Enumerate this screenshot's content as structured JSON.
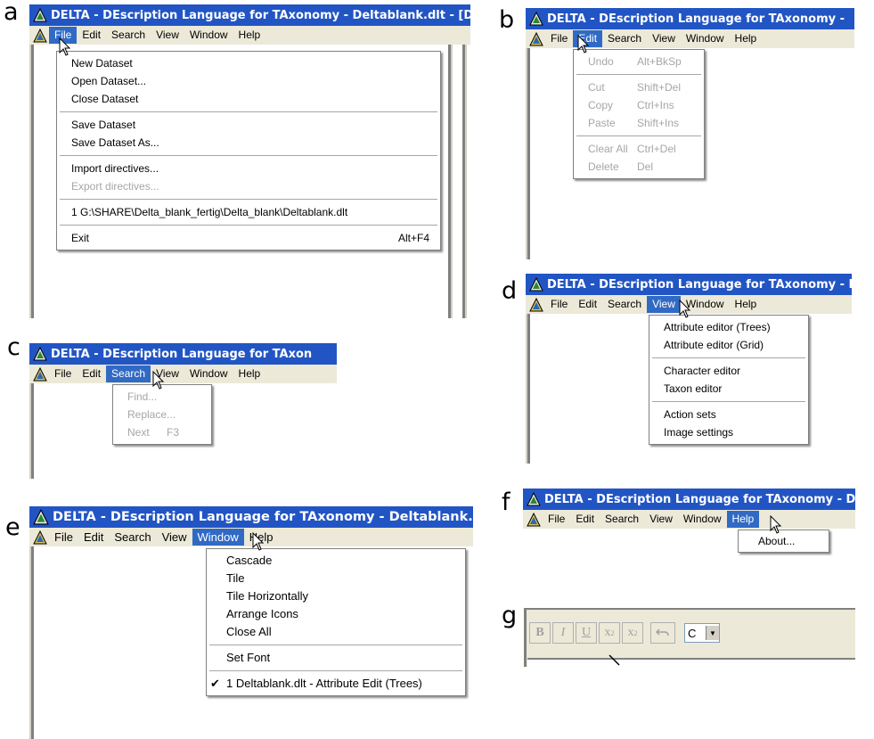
{
  "panels": {
    "a": {
      "letter": "a",
      "title": "DELTA - DEscription Language for TAxonomy - Deltablank.dlt - [Delt",
      "menu": [
        "File",
        "Edit",
        "Search",
        "View",
        "Window",
        "Help"
      ],
      "active_menu": "File",
      "items": {
        "new": "New Dataset",
        "open": "Open Dataset...",
        "close": "Close Dataset",
        "save": "Save Dataset",
        "save_as": "Save Dataset As...",
        "import": "Import directives...",
        "export": "Export directives...",
        "recent": "1 G:\\SHARE\\Delta_blank_fertig\\Delta_blank\\Deltablank.dlt",
        "exit": "Exit",
        "exit_shortcut": "Alt+F4"
      }
    },
    "b": {
      "letter": "b",
      "title": "DELTA - DEscription Language for TAxonomy -",
      "menu": [
        "File",
        "Edit",
        "Search",
        "View",
        "Window",
        "Help"
      ],
      "active_menu": "Edit",
      "items": {
        "undo": "Undo",
        "undo_shortcut": "Alt+BkSp",
        "cut": "Cut",
        "cut_shortcut": "Shift+Del",
        "copy": "Copy",
        "copy_shortcut": "Ctrl+Ins",
        "paste": "Paste",
        "paste_shortcut": "Shift+Ins",
        "clear_all": "Clear All",
        "clear_all_shortcut": "Ctrl+Del",
        "delete": "Delete",
        "delete_shortcut": "Del"
      }
    },
    "c": {
      "letter": "c",
      "title": "DELTA - DEscription Language for TAxon",
      "menu": [
        "File",
        "Edit",
        "Search",
        "View",
        "Window",
        "Help"
      ],
      "active_menu": "Search",
      "items": {
        "find": "Find...",
        "replace": "Replace...",
        "next": "Next",
        "next_shortcut": "F3"
      }
    },
    "d": {
      "letter": "d",
      "title": "DELTA - DEscription Language for TAxonomy - De",
      "menu": [
        "File",
        "Edit",
        "Search",
        "View",
        "Window",
        "Help"
      ],
      "active_menu": "View",
      "items": {
        "attr_trees": "Attribute editor (Trees)",
        "attr_grid": "Attribute editor (Grid)",
        "char_editor": "Character editor",
        "taxon_editor": "Taxon editor",
        "action_sets": "Action sets",
        "image_settings": "Image settings"
      }
    },
    "e": {
      "letter": "e",
      "title": "DELTA - DEscription Language for TAxonomy - Deltablank.dlt",
      "menu": [
        "File",
        "Edit",
        "Search",
        "View",
        "Window",
        "Help"
      ],
      "active_menu": "Window",
      "items": {
        "cascade": "Cascade",
        "tile": "Tile",
        "tile_h": "Tile Horizontally",
        "arrange": "Arrange Icons",
        "close_all": "Close All",
        "set_font": "Set Font",
        "window1": "1 Deltablank.dlt - Attribute Edit (Trees)"
      }
    },
    "f": {
      "letter": "f",
      "title": "DELTA - DEscription Language for TAxonomy - Del",
      "menu": [
        "File",
        "Edit",
        "Search",
        "View",
        "Window",
        "Help"
      ],
      "active_menu": "Help",
      "items": {
        "about": "About..."
      }
    },
    "g": {
      "letter": "g",
      "toolbar": {
        "bold": "B",
        "italic": "I",
        "underline": "U",
        "superscript": "x",
        "superscript_mark": "2",
        "subscript": "x",
        "subscript_mark": "2",
        "combo_value": "C"
      }
    }
  },
  "colors": {
    "titlebar": "#2255c4",
    "menu_highlight": "#316ac5",
    "menubar": "#ece9d8",
    "disabled_text": "#a6a6a6"
  },
  "icons": [
    "delta-app-icon",
    "mouse-cursor-icon",
    "checkmark-icon",
    "undo-arrow-icon",
    "dropdown-arrow-icon"
  ]
}
